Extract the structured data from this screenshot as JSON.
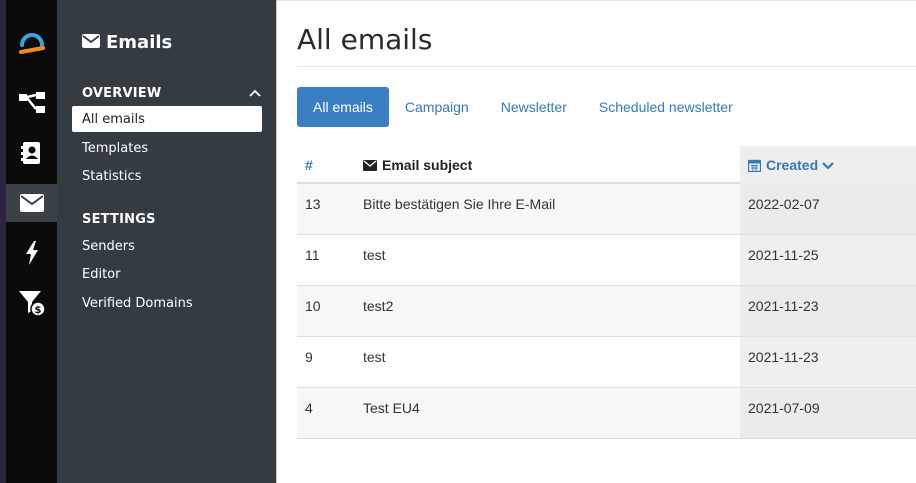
{
  "sidebar": {
    "title": "Emails",
    "sections": [
      {
        "heading": "OVERVIEW",
        "items": [
          "All emails",
          "Templates",
          "Statistics"
        ]
      },
      {
        "heading": "SETTINGS",
        "items": [
          "Senders",
          "Editor",
          "Verified Domains"
        ]
      }
    ],
    "active_item": "All emails"
  },
  "rail": {
    "icons": [
      "app-logo-icon",
      "flow-icon",
      "contacts-icon",
      "envelope-icon",
      "bolt-icon",
      "funnel-dollar-icon"
    ],
    "active": "envelope-icon"
  },
  "main": {
    "title": "All emails",
    "tabs": [
      "All emails",
      "Campaign",
      "Newsletter",
      "Scheduled newsletter"
    ],
    "active_tab": "All emails",
    "table": {
      "columns": {
        "id": "#",
        "subject": "Email subject",
        "created": "Created"
      },
      "sort": {
        "column": "Created",
        "direction": "descending"
      },
      "rows": [
        {
          "id": "13",
          "subject": "Bitte bestätigen Sie Ihre E-Mail",
          "created": "2022-02-07"
        },
        {
          "id": "11",
          "subject": "test",
          "created": "2021-11-25"
        },
        {
          "id": "10",
          "subject": "test2",
          "created": "2021-11-23"
        },
        {
          "id": "9",
          "subject": "test",
          "created": "2021-11-23"
        },
        {
          "id": "4",
          "subject": "Test EU4",
          "created": "2021-07-09"
        }
      ]
    }
  },
  "colors": {
    "accent": "#3a7fc1",
    "link": "#337ab7",
    "sidebar": "#343c42",
    "rail": "#0b0b0b",
    "logo": "#f58a1f"
  }
}
